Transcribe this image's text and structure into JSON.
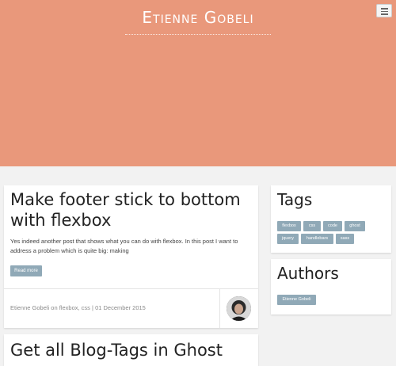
{
  "header": {
    "site_title": "Etienne Gobeli",
    "accent_color": "#e9987b",
    "menu_icon": "hamburger-icon"
  },
  "posts": [
    {
      "title": "Make footer stick to bottom with flexbox",
      "excerpt": "Yes indeed another post that shows what you can do with flexbox. In this post I want to address a problem which is quite big: making",
      "read_more_label": "Read more",
      "author": "Etienne Gobeli",
      "on_label": "on",
      "tags_text": "flexbox, css",
      "separator": "|",
      "date": "01 December 2015"
    },
    {
      "title": "Get all Blog-Tags in Ghost"
    }
  ],
  "sidebar": {
    "tags": {
      "title": "Tags",
      "items": [
        "flexbox",
        "css",
        "code",
        "ghost",
        "jquery",
        "handlebars",
        "sass"
      ]
    },
    "authors": {
      "title": "Authors",
      "items": [
        "Etienne Gobeli"
      ]
    }
  },
  "colors": {
    "chip_background": "#90a9b7",
    "page_background": "#f2f2f2"
  }
}
